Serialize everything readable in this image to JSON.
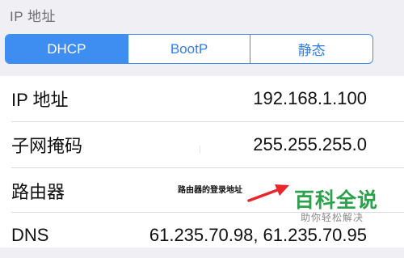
{
  "section_header": "IP 地址",
  "segments": [
    {
      "label": "DHCP",
      "selected": true
    },
    {
      "label": "BootP",
      "selected": false
    },
    {
      "label": "静态",
      "selected": false
    }
  ],
  "rows": [
    {
      "label": "IP 地址",
      "value": "192.168.1.100"
    },
    {
      "label": "子网掩码",
      "value": "255.255.255.0"
    },
    {
      "label": "路由器",
      "value": ""
    },
    {
      "label": "DNS",
      "value": "61.235.70.98, 61.235.70.95"
    }
  ],
  "annotation": "路由器的登录地址",
  "watermark": {
    "title": "百科全说",
    "subtitle": "助你轻松解决"
  },
  "colors": {
    "accent": "#3d8ef0",
    "watermark_green": "#2aa14a",
    "arrow_red": "#e8262b",
    "background": "#efeff4"
  }
}
